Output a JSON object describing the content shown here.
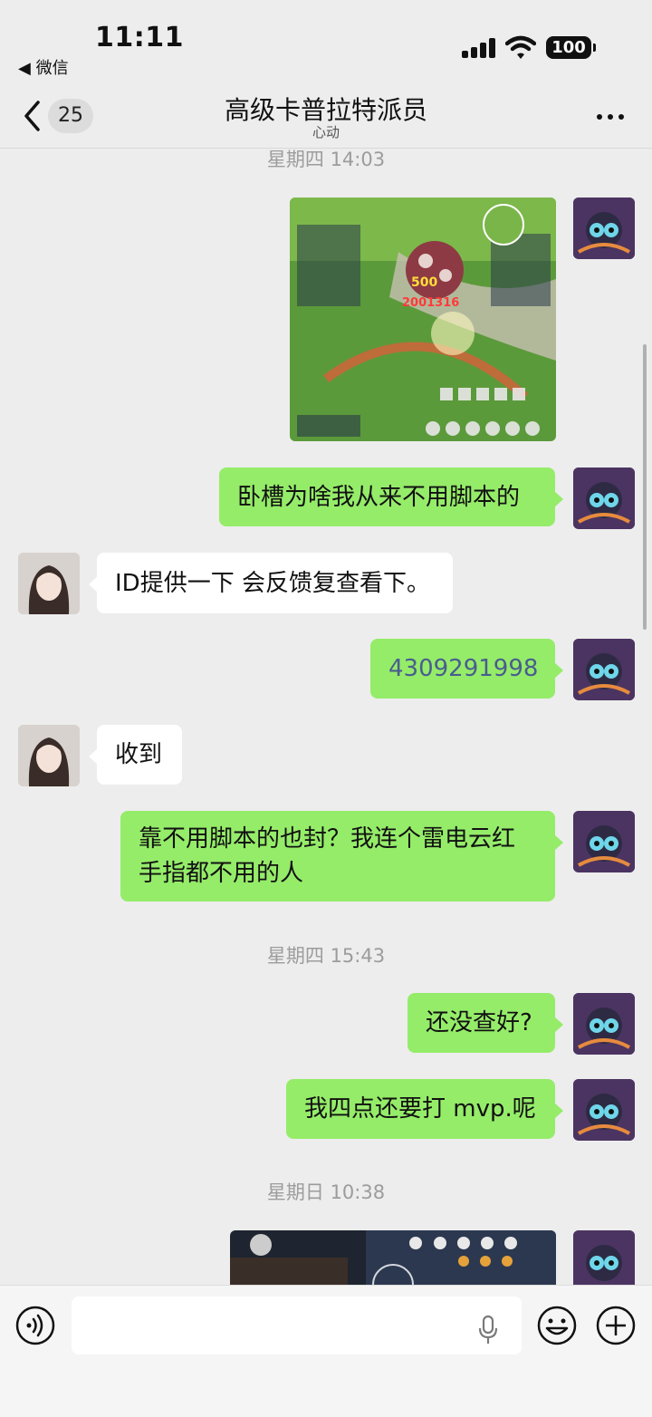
{
  "status_bar": {
    "time": "11:11",
    "back_app": "◀ 微信",
    "battery": "100"
  },
  "header": {
    "unread_count": "25",
    "title": "高级卡普拉特派员",
    "subtitle": "心动"
  },
  "messages": {
    "ts1": "星期四 14:03",
    "m1_text": "卧槽为啥我从来不用脚本的",
    "m2_text": "ID提供一下 会反馈复查看下。",
    "m3_text": "4309291998",
    "m4_text": "收到",
    "m5_line1": "靠不用脚本的也封？我连个雷电云红",
    "m5_line2": "手指都不用的人",
    "ts2": "星期四 15:43",
    "m6_text": "还没查好?",
    "m7_text": "我四点还要打 mvp.呢",
    "ts3": "星期日 10:38"
  },
  "colors": {
    "bubble_out": "#95ec69",
    "bubble_in": "#ffffff",
    "background": "#ededed"
  }
}
